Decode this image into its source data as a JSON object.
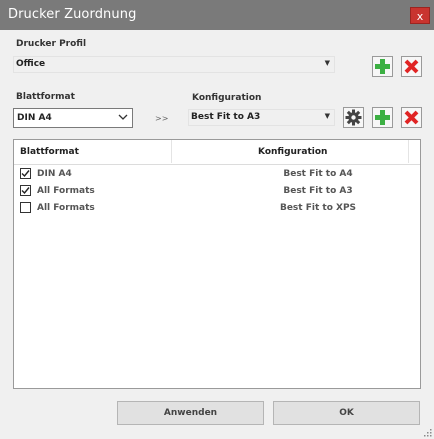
{
  "window": {
    "title": "Drucker Zuordnung",
    "close_label": "x"
  },
  "printer_profile": {
    "label": "Drucker Profil",
    "selected": "Office"
  },
  "sheet_format": {
    "label": "Blattformat",
    "selected": "DIN A4"
  },
  "arrow_separator": ">>",
  "configuration": {
    "label": "Konfiguration",
    "selected": "Best Fit to A3"
  },
  "icons": {
    "add": "plus-icon",
    "delete": "x-icon",
    "settings": "gear-icon"
  },
  "colors": {
    "add_green": "#3cb043",
    "delete_red": "#e02424",
    "title_bar": "#7a7a7a",
    "close_red": "#c9342f"
  },
  "table": {
    "columns": [
      "Blattformat",
      "Konfiguration"
    ],
    "rows": [
      {
        "checked": true,
        "format": "DIN A4",
        "config": "Best Fit to A4"
      },
      {
        "checked": true,
        "format": "All Formats",
        "config": "Best Fit to A3"
      },
      {
        "checked": false,
        "format": "All Formats",
        "config": "Best Fit to XPS"
      }
    ]
  },
  "buttons": {
    "apply": "Anwenden",
    "ok": "OK"
  }
}
